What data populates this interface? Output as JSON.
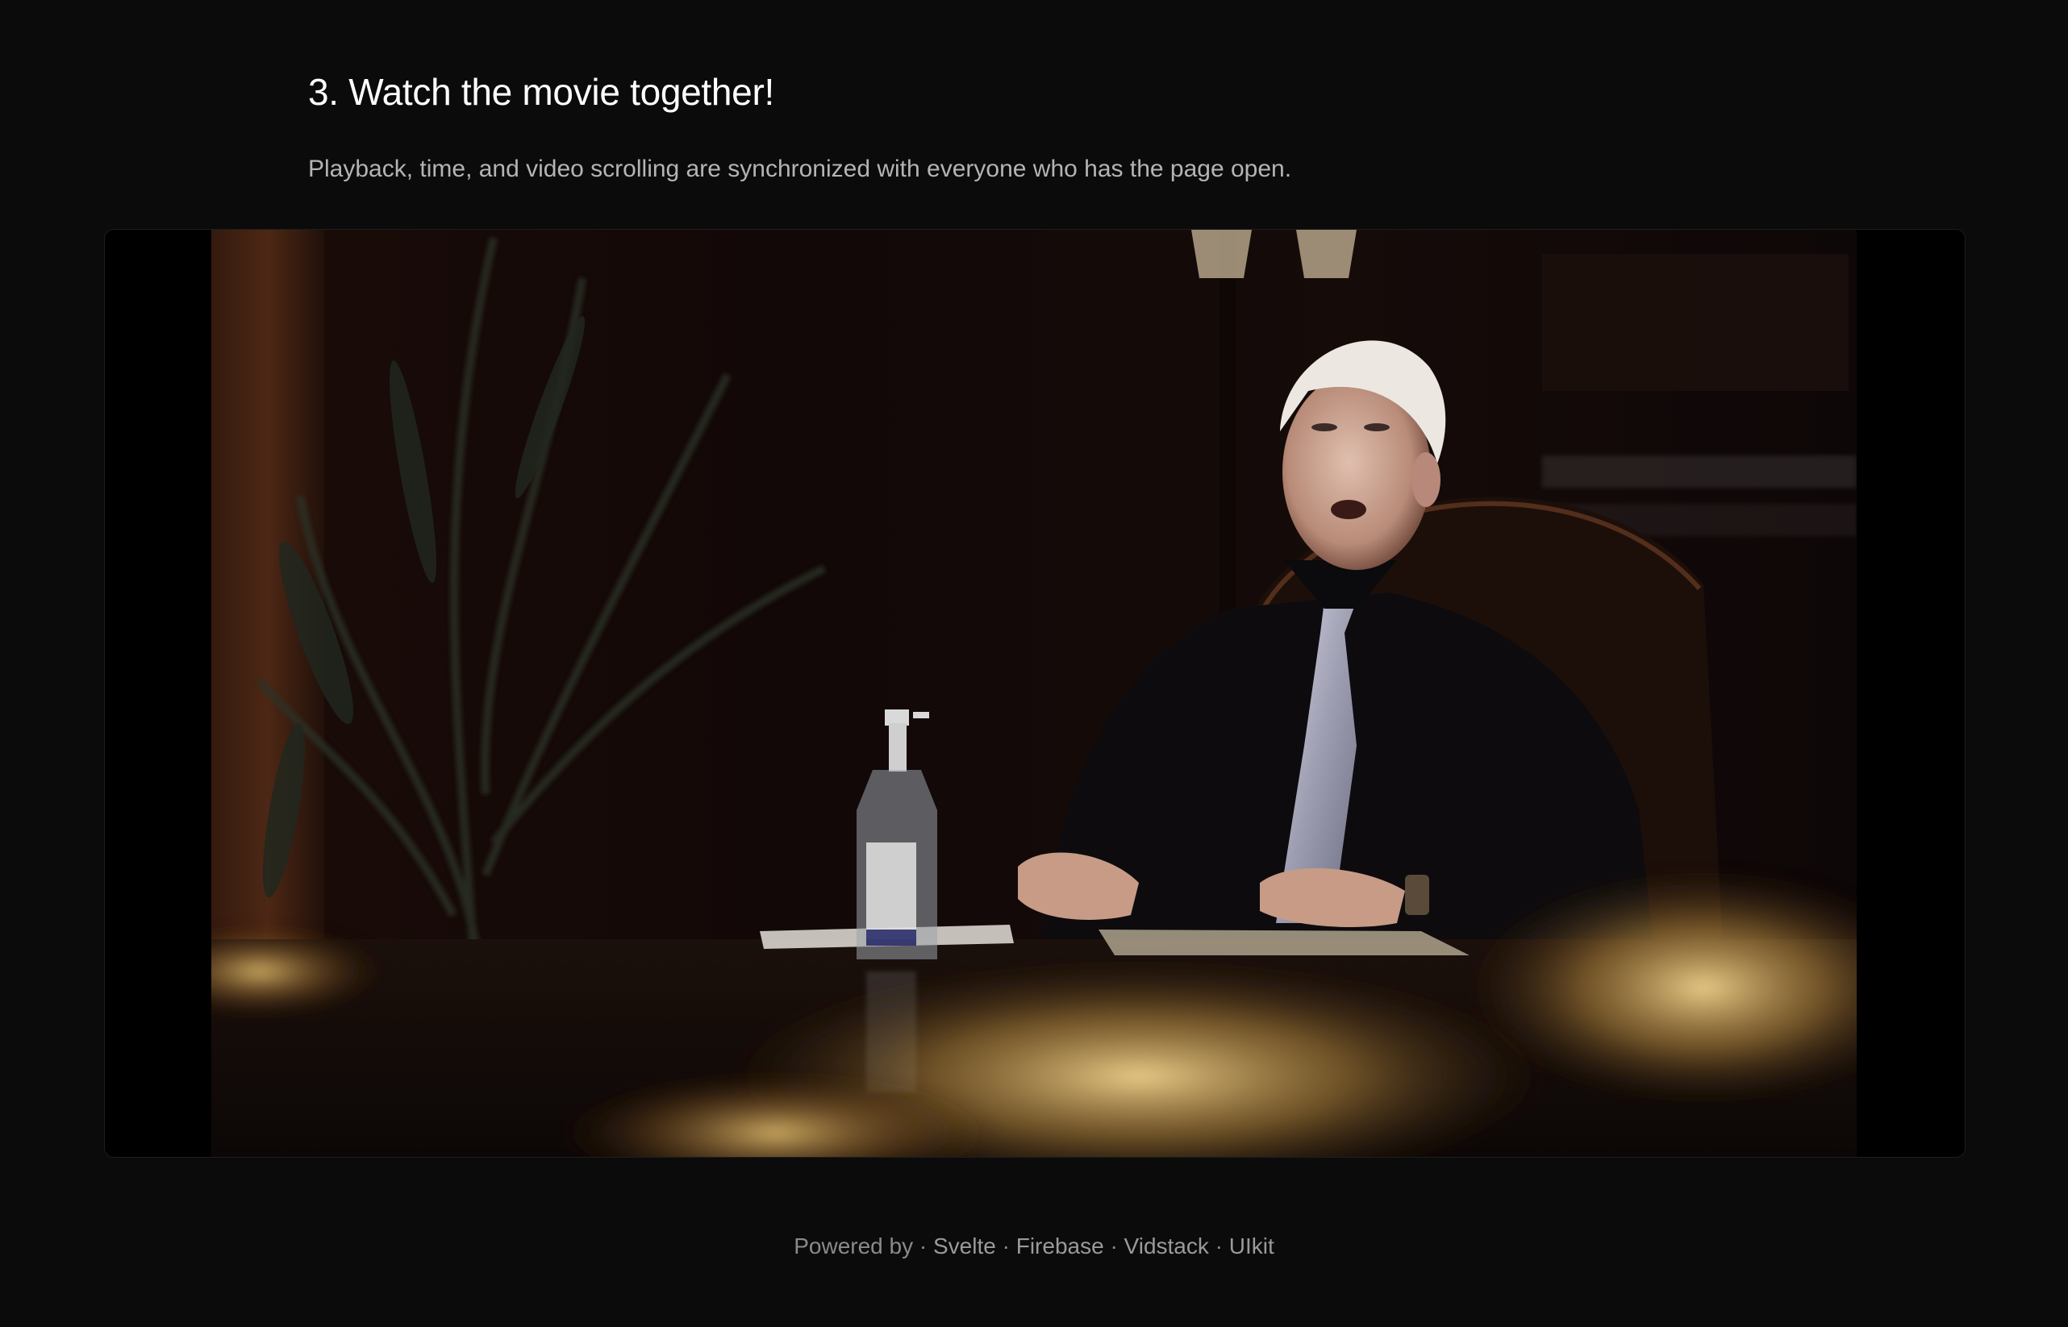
{
  "section": {
    "title": "3. Watch the movie together!",
    "description": "Playback, time, and video scrolling are synchronized with everyone who has the page open."
  },
  "footer": {
    "prefix": "Powered by",
    "separator": "·",
    "links": [
      "Svelte",
      "Firebase",
      "Vidstack",
      "UIkit"
    ]
  }
}
